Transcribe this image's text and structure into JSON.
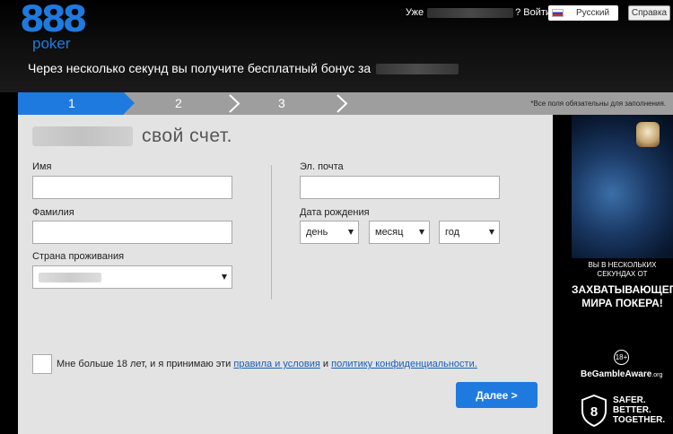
{
  "header": {
    "logo_digits": "888",
    "logo_word": "poker",
    "already_label": "Уже",
    "login_label": "? Войти",
    "language": "Русский",
    "help": "Справка",
    "bonus_text": "Через несколько секунд вы получите бесплатный бонус за"
  },
  "steps": {
    "items": [
      "1",
      "2",
      "3"
    ],
    "active": "1",
    "required_note": "*Все поля обязательны для заполнения."
  },
  "form": {
    "title_suffix": "свой счет.",
    "first_name_label": "Имя",
    "first_name_value": "",
    "last_name_label": "Фамилия",
    "last_name_value": "",
    "country_label": "Страна проживания",
    "email_label": "Эл. почта",
    "email_value": "",
    "dob_label": "Дата рождения",
    "dob_day": "день",
    "dob_month": "месяц",
    "dob_year": "год",
    "agree_prefix": "Мне больше 18 лет, и я принимаю эти",
    "terms_link": "правила и условия",
    "agree_and": "и",
    "privacy_link": "политику конфиденциальности.",
    "next_button": "Далее >"
  },
  "ad": {
    "small_text": "ВЫ В НЕСКОЛЬКИХ СЕКУНДАХ ОТ",
    "big_text": "ЗАХВАТЫВАЮЩЕГО МИРА ПОКЕРА!",
    "age_badge": "18+",
    "gamble_aware": "BeGambleAware",
    "gamble_aware_suffix": ".org",
    "shield_number": "8",
    "safer_line1": "SAFER.",
    "safer_line2": "BETTER.",
    "safer_line3": "TOGETHER."
  },
  "colors": {
    "brand_blue": "#1f7ae0",
    "steps_bar": "#9e9e9e",
    "panel_bg": "#e3e3e3"
  }
}
